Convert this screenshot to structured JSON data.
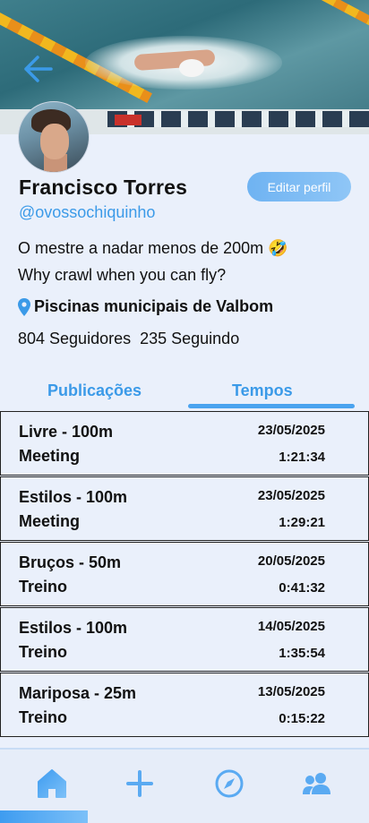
{
  "profile": {
    "name": "Francisco Torres",
    "handle": "@ovossochiquinho",
    "edit_label": "Editar perfil",
    "bio_line1": "O mestre a nadar menos de 200m 🤣",
    "bio_line2": "Why crawl when you can fly?",
    "location": "Piscinas municipais de Valbom",
    "followers": "804 Seguidores  235 Seguindo"
  },
  "tabs": [
    {
      "label": "Publicações",
      "active": false
    },
    {
      "label": "Tempos",
      "active": true
    }
  ],
  "times": [
    {
      "event": "Livre - 100m",
      "type": "Meeting",
      "date": "23/05/2025",
      "time": "1:21:34"
    },
    {
      "event": "Estilos - 100m",
      "type": "Meeting",
      "date": "23/05/2025",
      "time": "1:29:21"
    },
    {
      "event": "Bruços - 50m",
      "type": "Treino",
      "date": "20/05/2025",
      "time": "0:41:32"
    },
    {
      "event": "Estilos - 100m",
      "type": "Treino",
      "date": "14/05/2025",
      "time": "1:35:54"
    },
    {
      "event": "Mariposa - 25m",
      "type": "Treino",
      "date": "13/05/2025",
      "time": "0:15:22"
    }
  ],
  "nav": {
    "items": [
      "home-icon",
      "plus-icon",
      "compass-icon",
      "people-icon"
    ],
    "active": "home-icon"
  },
  "colors": {
    "accent": "#3b9ae8",
    "background": "#eaf0fb",
    "button": "#7fbdf4"
  }
}
